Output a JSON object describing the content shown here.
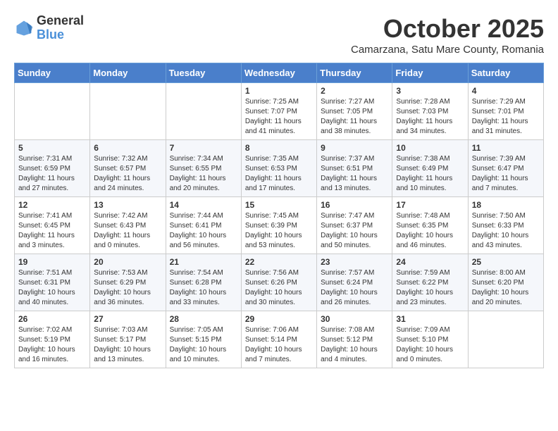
{
  "header": {
    "logo": {
      "general": "General",
      "blue": "Blue"
    },
    "month_title": "October 2025",
    "subtitle": "Camarzana, Satu Mare County, Romania"
  },
  "calendar": {
    "weekdays": [
      "Sunday",
      "Monday",
      "Tuesday",
      "Wednesday",
      "Thursday",
      "Friday",
      "Saturday"
    ],
    "weeks": [
      [
        {
          "num": "",
          "info": ""
        },
        {
          "num": "",
          "info": ""
        },
        {
          "num": "",
          "info": ""
        },
        {
          "num": "1",
          "info": "Sunrise: 7:25 AM\nSunset: 7:07 PM\nDaylight: 11 hours\nand 41 minutes."
        },
        {
          "num": "2",
          "info": "Sunrise: 7:27 AM\nSunset: 7:05 PM\nDaylight: 11 hours\nand 38 minutes."
        },
        {
          "num": "3",
          "info": "Sunrise: 7:28 AM\nSunset: 7:03 PM\nDaylight: 11 hours\nand 34 minutes."
        },
        {
          "num": "4",
          "info": "Sunrise: 7:29 AM\nSunset: 7:01 PM\nDaylight: 11 hours\nand 31 minutes."
        }
      ],
      [
        {
          "num": "5",
          "info": "Sunrise: 7:31 AM\nSunset: 6:59 PM\nDaylight: 11 hours\nand 27 minutes."
        },
        {
          "num": "6",
          "info": "Sunrise: 7:32 AM\nSunset: 6:57 PM\nDaylight: 11 hours\nand 24 minutes."
        },
        {
          "num": "7",
          "info": "Sunrise: 7:34 AM\nSunset: 6:55 PM\nDaylight: 11 hours\nand 20 minutes."
        },
        {
          "num": "8",
          "info": "Sunrise: 7:35 AM\nSunset: 6:53 PM\nDaylight: 11 hours\nand 17 minutes."
        },
        {
          "num": "9",
          "info": "Sunrise: 7:37 AM\nSunset: 6:51 PM\nDaylight: 11 hours\nand 13 minutes."
        },
        {
          "num": "10",
          "info": "Sunrise: 7:38 AM\nSunset: 6:49 PM\nDaylight: 11 hours\nand 10 minutes."
        },
        {
          "num": "11",
          "info": "Sunrise: 7:39 AM\nSunset: 6:47 PM\nDaylight: 11 hours\nand 7 minutes."
        }
      ],
      [
        {
          "num": "12",
          "info": "Sunrise: 7:41 AM\nSunset: 6:45 PM\nDaylight: 11 hours\nand 3 minutes."
        },
        {
          "num": "13",
          "info": "Sunrise: 7:42 AM\nSunset: 6:43 PM\nDaylight: 11 hours\nand 0 minutes."
        },
        {
          "num": "14",
          "info": "Sunrise: 7:44 AM\nSunset: 6:41 PM\nDaylight: 10 hours\nand 56 minutes."
        },
        {
          "num": "15",
          "info": "Sunrise: 7:45 AM\nSunset: 6:39 PM\nDaylight: 10 hours\nand 53 minutes."
        },
        {
          "num": "16",
          "info": "Sunrise: 7:47 AM\nSunset: 6:37 PM\nDaylight: 10 hours\nand 50 minutes."
        },
        {
          "num": "17",
          "info": "Sunrise: 7:48 AM\nSunset: 6:35 PM\nDaylight: 10 hours\nand 46 minutes."
        },
        {
          "num": "18",
          "info": "Sunrise: 7:50 AM\nSunset: 6:33 PM\nDaylight: 10 hours\nand 43 minutes."
        }
      ],
      [
        {
          "num": "19",
          "info": "Sunrise: 7:51 AM\nSunset: 6:31 PM\nDaylight: 10 hours\nand 40 minutes."
        },
        {
          "num": "20",
          "info": "Sunrise: 7:53 AM\nSunset: 6:29 PM\nDaylight: 10 hours\nand 36 minutes."
        },
        {
          "num": "21",
          "info": "Sunrise: 7:54 AM\nSunset: 6:28 PM\nDaylight: 10 hours\nand 33 minutes."
        },
        {
          "num": "22",
          "info": "Sunrise: 7:56 AM\nSunset: 6:26 PM\nDaylight: 10 hours\nand 30 minutes."
        },
        {
          "num": "23",
          "info": "Sunrise: 7:57 AM\nSunset: 6:24 PM\nDaylight: 10 hours\nand 26 minutes."
        },
        {
          "num": "24",
          "info": "Sunrise: 7:59 AM\nSunset: 6:22 PM\nDaylight: 10 hours\nand 23 minutes."
        },
        {
          "num": "25",
          "info": "Sunrise: 8:00 AM\nSunset: 6:20 PM\nDaylight: 10 hours\nand 20 minutes."
        }
      ],
      [
        {
          "num": "26",
          "info": "Sunrise: 7:02 AM\nSunset: 5:19 PM\nDaylight: 10 hours\nand 16 minutes."
        },
        {
          "num": "27",
          "info": "Sunrise: 7:03 AM\nSunset: 5:17 PM\nDaylight: 10 hours\nand 13 minutes."
        },
        {
          "num": "28",
          "info": "Sunrise: 7:05 AM\nSunset: 5:15 PM\nDaylight: 10 hours\nand 10 minutes."
        },
        {
          "num": "29",
          "info": "Sunrise: 7:06 AM\nSunset: 5:14 PM\nDaylight: 10 hours\nand 7 minutes."
        },
        {
          "num": "30",
          "info": "Sunrise: 7:08 AM\nSunset: 5:12 PM\nDaylight: 10 hours\nand 4 minutes."
        },
        {
          "num": "31",
          "info": "Sunrise: 7:09 AM\nSunset: 5:10 PM\nDaylight: 10 hours\nand 0 minutes."
        },
        {
          "num": "",
          "info": ""
        }
      ]
    ]
  }
}
